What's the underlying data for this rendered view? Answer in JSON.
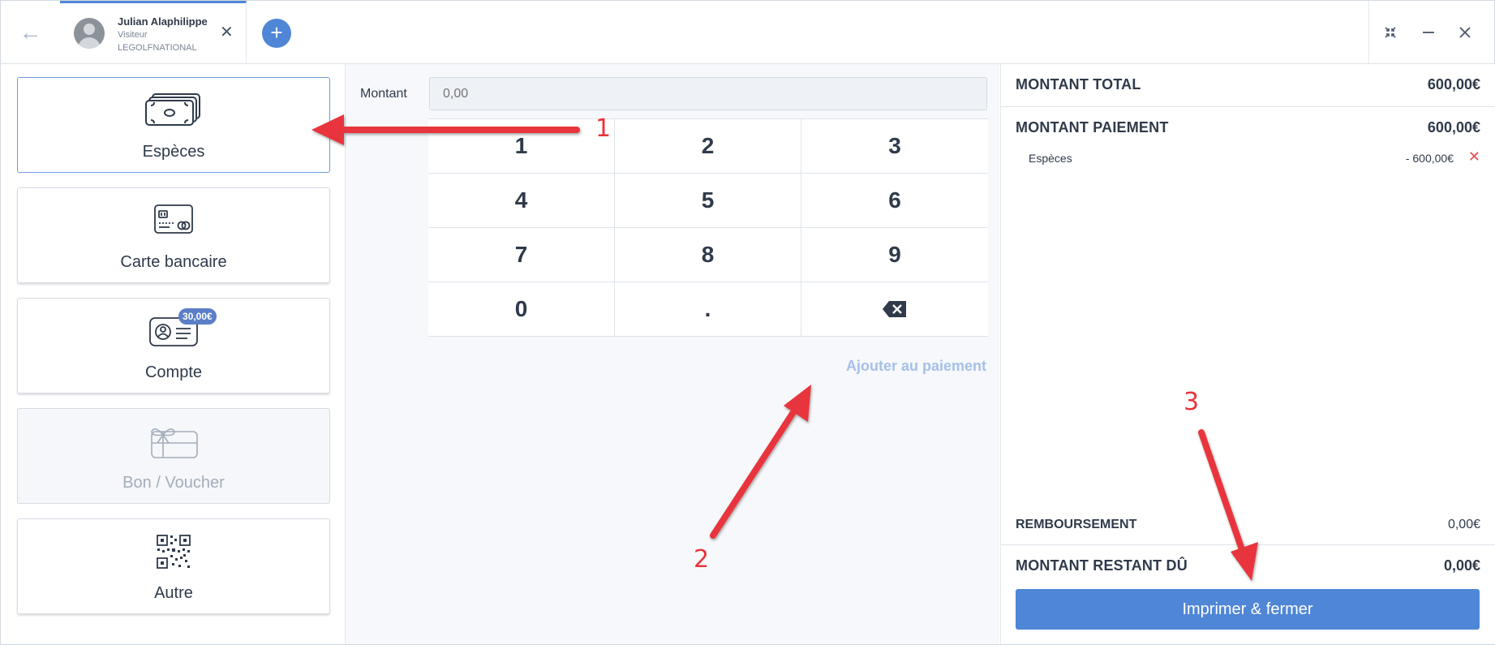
{
  "header": {
    "user_name": "Julian Alaphilippe",
    "user_role": "Visiteur",
    "club": "LEGOLFNATIONAL"
  },
  "payment_methods": [
    {
      "label": "Espèces",
      "icon": "cash-icon",
      "state": "selected"
    },
    {
      "label": "Carte bancaire",
      "icon": "credit-card-icon",
      "state": "normal"
    },
    {
      "label": "Compte",
      "icon": "account-card-icon",
      "state": "normal",
      "badge": "30,00€"
    },
    {
      "label": "Bon / Voucher",
      "icon": "gift-card-icon",
      "state": "disabled"
    },
    {
      "label": "Autre",
      "icon": "qr-code-icon",
      "state": "normal"
    }
  ],
  "amount": {
    "label": "Montant",
    "placeholder": "0,00"
  },
  "keypad": [
    "1",
    "2",
    "3",
    "4",
    "5",
    "6",
    "7",
    "8",
    "9",
    "0",
    ".",
    "⌫"
  ],
  "add_payment_label": "Ajouter au paiement",
  "summary": {
    "total_label": "MONTANT TOTAL",
    "total_value": "600,00€",
    "payment_label": "MONTANT PAIEMENT",
    "payment_value": "600,00€",
    "lines": [
      {
        "label": "Espèces",
        "value": "- 600,00€"
      }
    ],
    "refund_label": "REMBOURSEMENT",
    "refund_value": "0,00€",
    "remaining_label": "MONTANT RESTANT DÛ",
    "remaining_value": "0,00€",
    "print_button": "Imprimer & fermer"
  },
  "annotations": [
    "1",
    "2",
    "3"
  ],
  "colors": {
    "accent": "#4f86d6",
    "annotation": "#e8343c",
    "remove": "#e74c4c"
  }
}
